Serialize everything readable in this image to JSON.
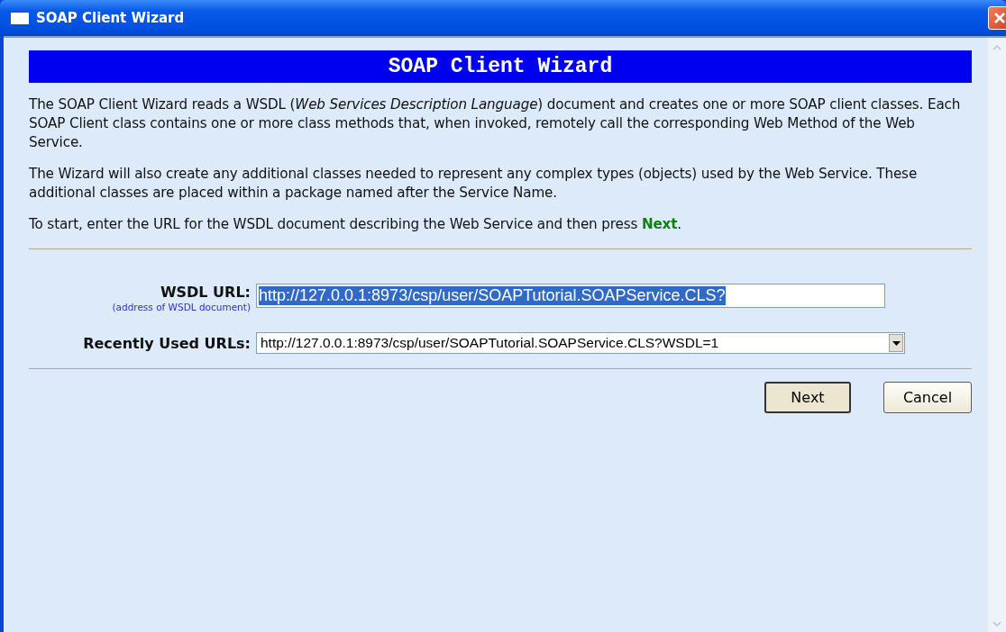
{
  "window": {
    "title": "SOAP Client Wizard"
  },
  "heading": "SOAP Client Wizard",
  "paragraphs": [
    "The SOAP Client Wizard reads a WSDL (*Web Services Description Language*) document and creates one or more SOAP client classes. Each SOAP Client class contains one or more class methods that, when invoked, remotely call the corresponding Web Method of the Web Service.",
    "The Wizard will also create any additional classes needed to represent any complex types (objects) used by the Web Service. These additional classes are placed within a package named after the Service Name.",
    "To start, enter the URL for the WSDL document describing the Web Service and then press **Next**."
  ],
  "wsdl_url": {
    "label": "WSDL URL:",
    "hint": "(address of WSDL document)",
    "value": "http://127.0.0.1:8973/csp/user/SOAPTutorial.SOAPService.CLS?",
    "text_selected": true
  },
  "recent_urls": {
    "label": "Recently Used URLs:",
    "value": "http://127.0.0.1:8973/csp/user/SOAPTutorial.SOAPService.CLS?WSDL=1"
  },
  "buttons": [
    {
      "label": "Next",
      "focused": true
    },
    {
      "label": "Cancel",
      "focused": false
    }
  ]
}
